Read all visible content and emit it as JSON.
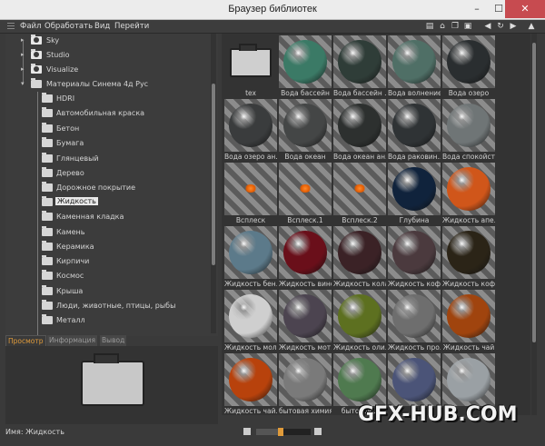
{
  "window": {
    "title": "Браузер библиотек",
    "controls": {
      "minimize": "–",
      "maximize": "☐",
      "close": "✕"
    }
  },
  "menu": [
    "Файл",
    "Обработать",
    "Вид",
    "Перейти"
  ],
  "toolbar_icons": [
    "list-view-icon",
    "home-icon",
    "copy-icon",
    "window-icon",
    "history-icon",
    "back-icon",
    "forward-icon",
    "pin-icon"
  ],
  "tree": [
    {
      "label": "Sky",
      "level": 1,
      "expanded": false
    },
    {
      "label": "Studio",
      "level": 1,
      "expanded": false
    },
    {
      "label": "Visualize",
      "level": 1,
      "expanded": false
    },
    {
      "label": "Материалы Синема 4д Рус",
      "level": 1,
      "expanded": true
    },
    {
      "label": "HDRI",
      "level": 2
    },
    {
      "label": "Автомобильная краска",
      "level": 2
    },
    {
      "label": "Бетон",
      "level": 2
    },
    {
      "label": "Бумага",
      "level": 2
    },
    {
      "label": "Глянцевый",
      "level": 2
    },
    {
      "label": "Дерево",
      "level": 2
    },
    {
      "label": "Дорожное покрытие",
      "level": 2
    },
    {
      "label": "Жидкость",
      "level": 2,
      "selected": true
    },
    {
      "label": "Каменная кладка",
      "level": 2
    },
    {
      "label": "Камень",
      "level": 2
    },
    {
      "label": "Керамика",
      "level": 2
    },
    {
      "label": "Кирпичи",
      "level": 2
    },
    {
      "label": "Космос",
      "level": 2
    },
    {
      "label": "Крыша",
      "level": 2
    },
    {
      "label": "Люди, животные, птицы, рыбы",
      "level": 2
    },
    {
      "label": "Металл",
      "level": 2
    }
  ],
  "tabs": [
    "Просмотр",
    "Информация",
    "Вывод"
  ],
  "active_tab": "Просмотр",
  "name_line": "Имя: Жидкость",
  "items": [
    {
      "label": "tex",
      "kind": "folder"
    },
    {
      "label": "Вода бассейн",
      "color": "#3b7a66"
    },
    {
      "label": "Вода бассейн ...",
      "color": "#2f3d38"
    },
    {
      "label": "Вода волнение",
      "color": "#4f6f66"
    },
    {
      "label": "Вода озеро",
      "color": "#2a2e30"
    },
    {
      "label": "Вода озеро ан...",
      "color": "#3a3c3d"
    },
    {
      "label": "Вода океан",
      "color": "#444646"
    },
    {
      "label": "Вода океан ан...",
      "color": "#2d302f"
    },
    {
      "label": "Вода раковин...",
      "color": "#2f3335"
    },
    {
      "label": "Вода спокойст...",
      "color": "#6f7576"
    },
    {
      "label": "Всплеск",
      "kind": "splat"
    },
    {
      "label": "Всплеск.1",
      "kind": "splat"
    },
    {
      "label": "Всплеск.2",
      "kind": "splat"
    },
    {
      "label": "Глубина",
      "color": "#10233c"
    },
    {
      "label": "Жидкость апе...",
      "color": "#d0561a"
    },
    {
      "label": "Жидкость бен...",
      "color": "#5c7a8a"
    },
    {
      "label": "Жидкость вино",
      "color": "#6a0f1a"
    },
    {
      "label": "Жидкость кола",
      "color": "#3b2226"
    },
    {
      "label": "Жидкость кофе",
      "color": "#4b3a3e"
    },
    {
      "label": "Жидкость коф...",
      "color": "#2b2417"
    },
    {
      "label": "Жидкость мол...",
      "color": "#cfcfcf"
    },
    {
      "label": "Жидкость мот...",
      "color": "#4c4450"
    },
    {
      "label": "Жидкость оли...",
      "color": "#5d7020"
    },
    {
      "label": "Жидкость про...",
      "color": "#6e6e6e"
    },
    {
      "label": "Жидкость чай",
      "color": "#a0440e"
    },
    {
      "label": "Жидкость чай.1",
      "color": "#b8420c"
    },
    {
      "label": "бытовая химия",
      "color": "#7a7a7a"
    },
    {
      "label": "бытовая...",
      "color": "#4f7a4f"
    },
    {
      "label": "",
      "color": "#4b5478"
    },
    {
      "label": "",
      "color": "#9aa0a4"
    }
  ],
  "zoom": 0.45,
  "watermark": "GFX-HUB.COM"
}
